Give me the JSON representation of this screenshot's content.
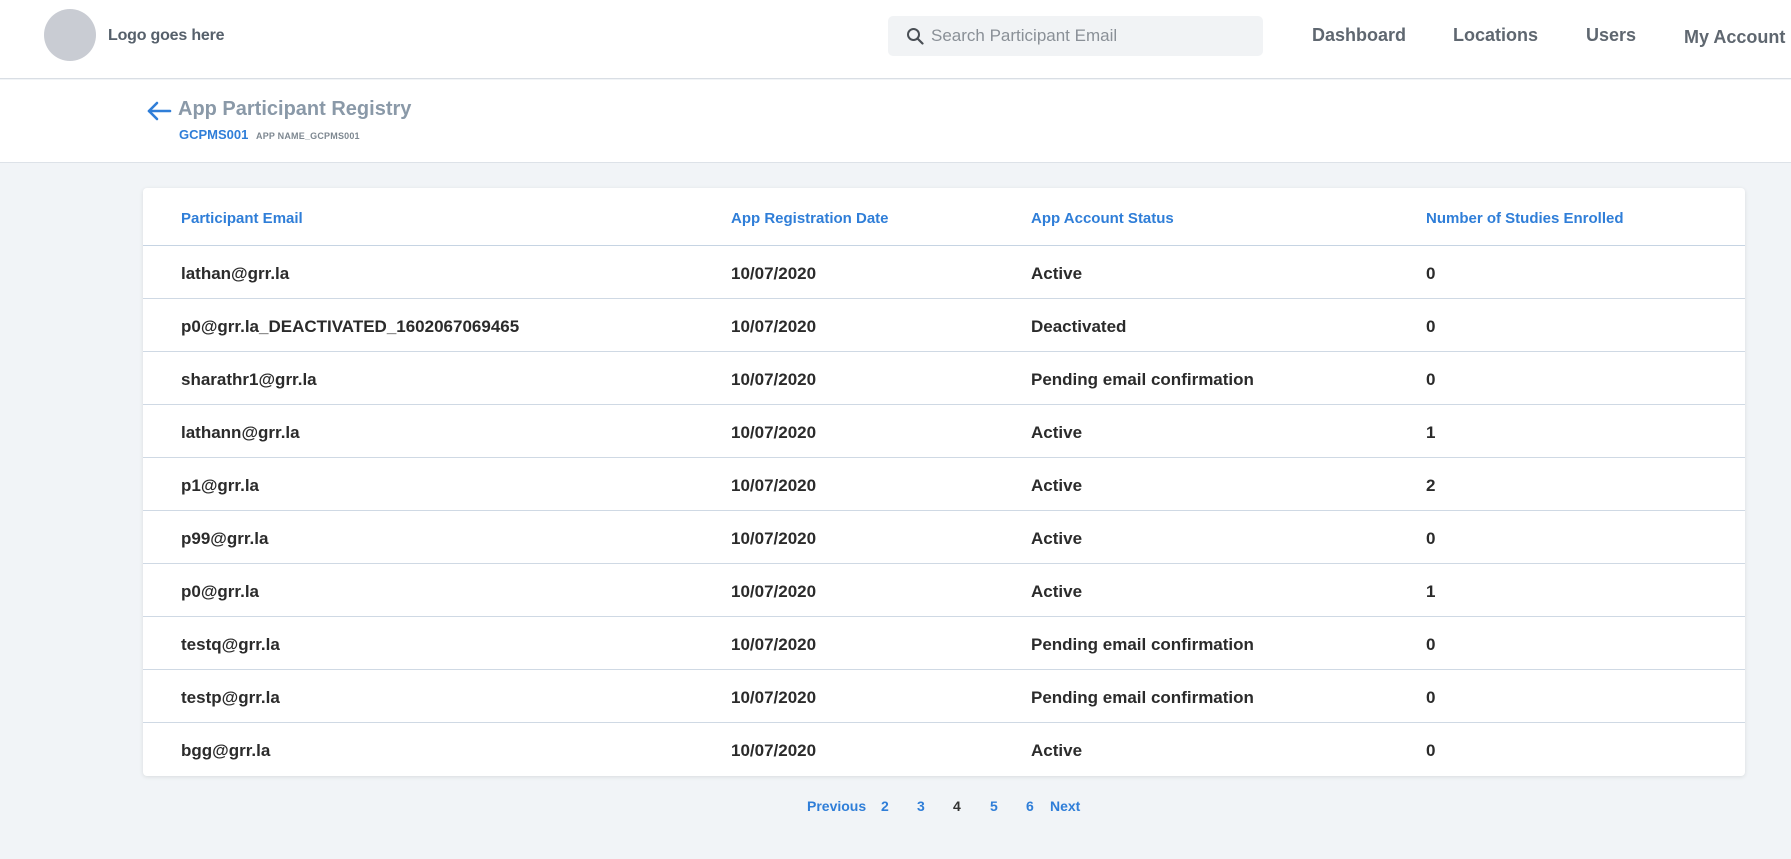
{
  "header": {
    "logo_text": "Logo goes here",
    "search_placeholder": "Search Participant Email",
    "nav": [
      "Dashboard",
      "Locations",
      "Users",
      "My Account"
    ]
  },
  "page": {
    "title": "App Participant Registry",
    "app_id": "GCPMS001",
    "app_name": "APP NAME_GCPMS001"
  },
  "table": {
    "columns": [
      "Participant Email",
      "App Registration Date",
      "App Account Status",
      "Number of Studies Enrolled"
    ],
    "rows": [
      {
        "email": "lathan@grr.la",
        "date": "10/07/2020",
        "status": "Active",
        "studies": "0"
      },
      {
        "email": "p0@grr.la_DEACTIVATED_1602067069465",
        "date": "10/07/2020",
        "status": "Deactivated",
        "studies": "0"
      },
      {
        "email": "sharathr1@grr.la",
        "date": "10/07/2020",
        "status": "Pending email confirmation",
        "studies": "0"
      },
      {
        "email": "lathann@grr.la",
        "date": "10/07/2020",
        "status": "Active",
        "studies": "1"
      },
      {
        "email": "p1@grr.la",
        "date": "10/07/2020",
        "status": "Active",
        "studies": "2"
      },
      {
        "email": "p99@grr.la",
        "date": "10/07/2020",
        "status": "Active",
        "studies": "0"
      },
      {
        "email": "p0@grr.la",
        "date": "10/07/2020",
        "status": "Active",
        "studies": "1"
      },
      {
        "email": "testq@grr.la",
        "date": "10/07/2020",
        "status": "Pending email confirmation",
        "studies": "0"
      },
      {
        "email": "testp@grr.la",
        "date": "10/07/2020",
        "status": "Pending email confirmation",
        "studies": "0"
      },
      {
        "email": "bgg@grr.la",
        "date": "10/07/2020",
        "status": "Active",
        "studies": "0"
      }
    ]
  },
  "pagination": {
    "previous": "Previous",
    "pages": [
      "2",
      "3",
      "4",
      "5",
      "6"
    ],
    "current": "4",
    "next": "Next"
  },
  "colors": {
    "accent": "#2f7ed8",
    "background": "#f1f4f7"
  }
}
